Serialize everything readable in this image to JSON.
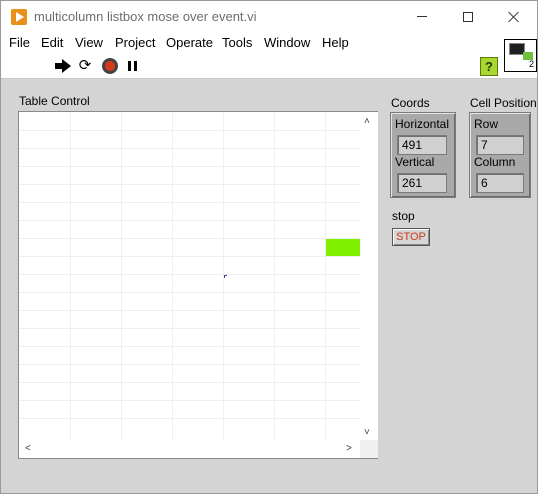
{
  "window": {
    "title": "multicolumn listbox mose over event.vi",
    "controls": {
      "minimize": "minimize",
      "maximize": "maximize",
      "close": "close"
    }
  },
  "menu": {
    "items": [
      "File",
      "Edit",
      "View",
      "Project",
      "Operate",
      "Tools",
      "Window",
      "Help"
    ]
  },
  "toolbar": {
    "icons": [
      "run-arrow-icon",
      "run-continuously-icon",
      "abort-execution-icon",
      "pause-icon"
    ],
    "help_label": "?",
    "vi_icon_number": "2"
  },
  "table_control": {
    "label": "Table Control",
    "highlighted_cell_color": "#7ff000"
  },
  "coords": {
    "label": "Coords",
    "horizontal_label": "Horizontal",
    "horizontal_value": "491",
    "vertical_label": "Vertical",
    "vertical_value": "261"
  },
  "cell_position": {
    "label": "Cell Position",
    "row_label": "Row",
    "row_value": "7",
    "column_label": "Column",
    "column_value": "6"
  },
  "stop": {
    "label": "stop",
    "button_text": "STOP"
  }
}
